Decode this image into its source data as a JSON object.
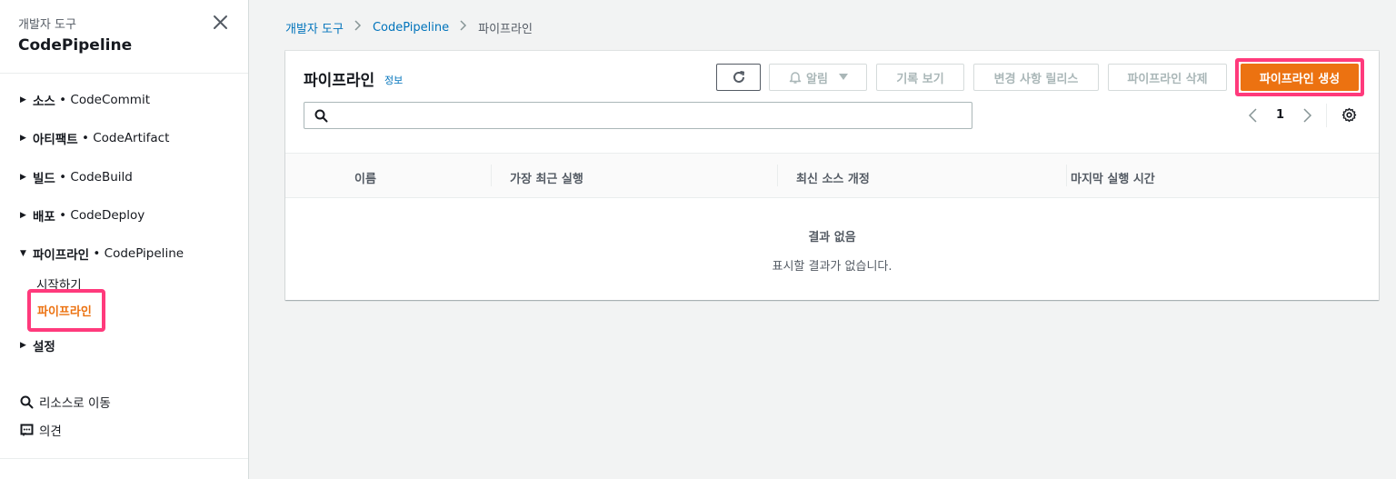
{
  "sidebar": {
    "service_label": "개발자 도구",
    "title": "CodePipeline",
    "sections": [
      {
        "name": "소스",
        "service": "CodeCommit",
        "expanded": false
      },
      {
        "name": "아티팩트",
        "service": "CodeArtifact",
        "expanded": false
      },
      {
        "name": "빌드",
        "service": "CodeBuild",
        "expanded": false
      },
      {
        "name": "배포",
        "service": "CodeDeploy",
        "expanded": false
      },
      {
        "name": "파이프라인",
        "service": "CodePipeline",
        "expanded": true
      }
    ],
    "separator": " • ",
    "pipeline_items": [
      "시작하기",
      "파이프라인"
    ],
    "settings": "설정",
    "go_to_resource": "리소스로 이동",
    "feedback": "의견"
  },
  "breadcrumb": {
    "items": [
      "개발자 도구",
      "CodePipeline"
    ],
    "current": "파이프라인"
  },
  "panel": {
    "title": "파이프라인",
    "info": "정보",
    "buttons": {
      "notifications": "알림",
      "view_history": "기록 보기",
      "release_change": "변경 사항 릴리스",
      "delete_pipeline": "파이프라인 삭제",
      "create_pipeline": "파이프라인 생성"
    },
    "search": {
      "placeholder": "",
      "value": ""
    },
    "pagination": {
      "current_page": "1"
    },
    "columns": [
      "이름",
      "가장 최근 실행",
      "최신 소스 개정",
      "마지막 실행 시간"
    ],
    "empty_title": "결과 없음",
    "empty_description": "표시할 결과가 없습니다."
  },
  "colors": {
    "accent": "#ec7211",
    "link": "#0073bb",
    "highlight": "#ff3a7c"
  }
}
